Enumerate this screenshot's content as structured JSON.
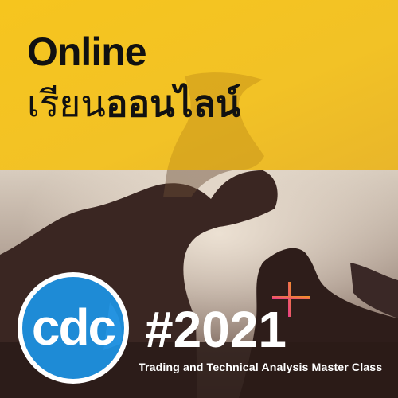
{
  "headline": {
    "line1": "Online",
    "line2_light": "เรียน",
    "line2_bold": "ออนไลน์"
  },
  "logo": {
    "text": "cdc"
  },
  "year_tag": "#2021",
  "tagline": "Trading and Technical Analysis Master Class",
  "colors": {
    "banner_yellow": "#F4C21F",
    "logo_blue": "#1E8BD6",
    "plus_pink": "#E8368F",
    "plus_orange": "#F39A1E"
  },
  "icons": {
    "plus": "plus-icon",
    "logo": "cdc-logo"
  }
}
